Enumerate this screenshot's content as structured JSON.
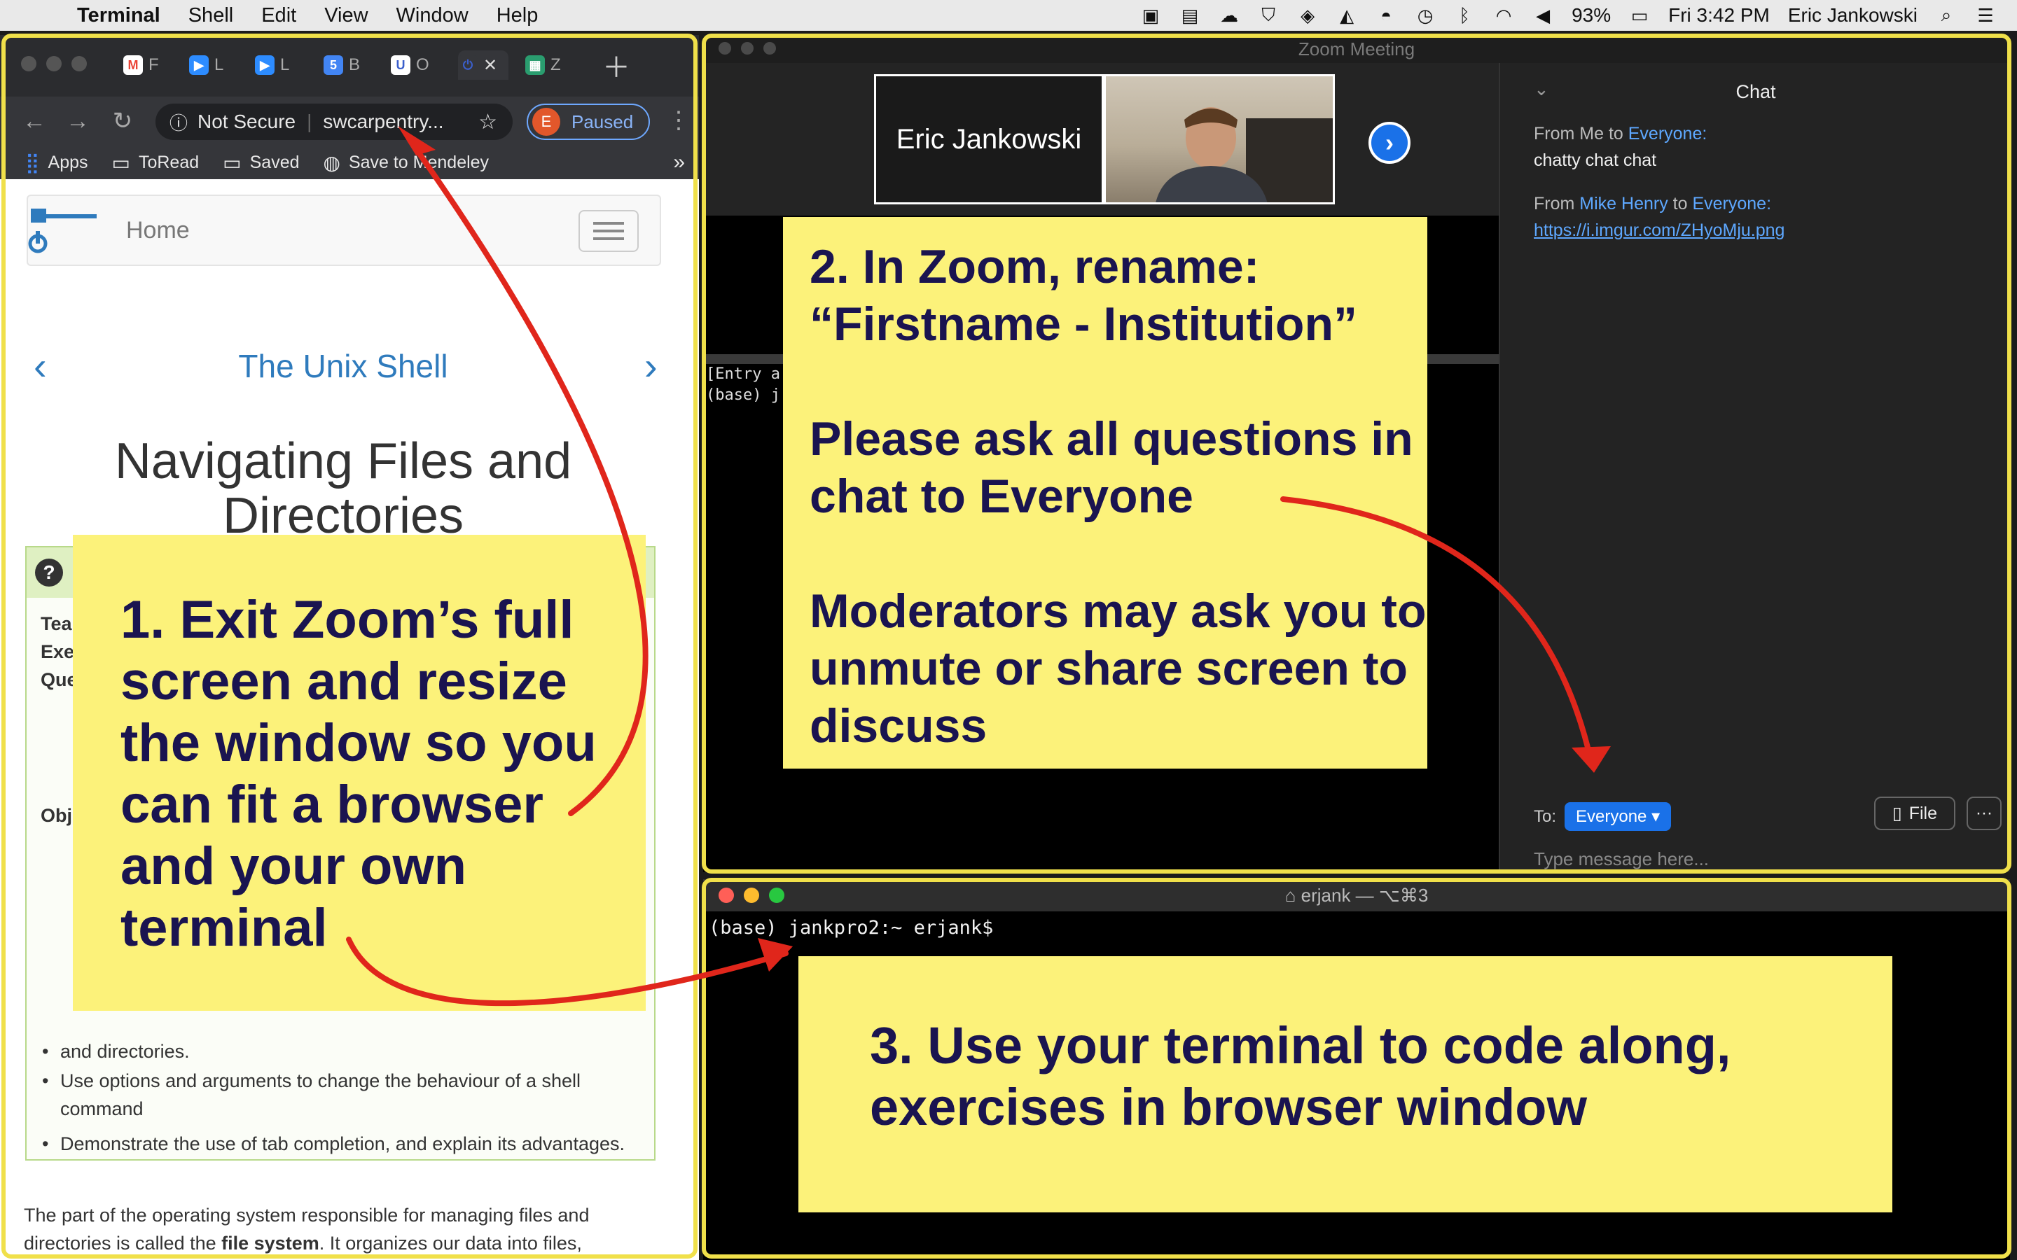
{
  "menubar": {
    "app": "Terminal",
    "menus": [
      "Shell",
      "Edit",
      "View",
      "Window",
      "Help"
    ],
    "battery": "93%",
    "clock": "Fri 3:42 PM",
    "user": "Eric Jankowski"
  },
  "browser": {
    "tabs": [
      {
        "initial": "F",
        "icon": "gmail-icon",
        "color": "#ea4335"
      },
      {
        "initial": "L",
        "icon": "zoom-icon",
        "color": "#2d8cff"
      },
      {
        "initial": "L",
        "icon": "zoom-icon",
        "color": "#2d8cff"
      },
      {
        "initial": "B",
        "icon": "calendar-icon",
        "color": "#4285f4"
      },
      {
        "initial": "O",
        "icon": "carpentries-icon",
        "color": "#3b5fcc"
      }
    ],
    "security_label": "Not Secure",
    "url": "swcarpentry...",
    "paused_label": "Paused",
    "avatar_initial": "E",
    "bookmarks": [
      "Apps",
      "ToRead",
      "Saved",
      "Save to Mendeley"
    ]
  },
  "page": {
    "nav_home": "Home",
    "lesson": "The Unix Shell",
    "title": "Navigating Files and Directories",
    "teaching_label": "Tea",
    "exercises_label": "Exe",
    "questions_label": "Que",
    "objectives_label": "Obj",
    "partial_bullet": "and directories.",
    "bullets": [
      "Use options and arguments to change the behaviour of a shell command",
      "Demonstrate the use of tab completion, and explain its advantages."
    ],
    "para_start": "The part of the operating system responsible for managing files and directories is called the ",
    "para_bold": "file system",
    "para_end": ". It organizes our data into files,"
  },
  "zoom": {
    "window_title": "Zoom Meeting",
    "participant_name": "Eric Jankowski",
    "mini_term_line1": "[Entry a",
    "mini_term_line2": "(base) j",
    "chat": {
      "title": "Chat",
      "msg1_from": "From Me to ",
      "msg1_to": "Everyone:",
      "msg1_text": "chatty chat chat",
      "msg2_from": "From ",
      "msg2_sender": "Mike Henry",
      "msg2_mid": " to ",
      "msg2_to": "Everyone:",
      "msg2_link": "https://i.imgur.com/ZHyoMju.png",
      "to_label": "To:",
      "recipient": "Everyone",
      "file_label": "File",
      "placeholder": "Type message here..."
    }
  },
  "terminal": {
    "title": "erjank — ⌥⌘3",
    "prompt": "(base) jankpro2:~ erjank$"
  },
  "notes": {
    "note1": "1. Exit Zoom’s full screen and resize the window so you can fit a browser and your own terminal",
    "note2_p1": "2. In Zoom, rename: “Firstname - Institution”",
    "note2_p2": "Please ask all questions in chat to Everyone",
    "note2_p3": "Moderators may ask you to unmute or share screen to discuss",
    "note3": "3. Use your terminal to code along, exercises in browser window"
  },
  "colors": {
    "note_yellow": "#fcf27a",
    "frame_yellow": "#f0e04a",
    "arrow_red": "#e0261b",
    "link_blue": "#2f7bbd",
    "zoom_blue": "#1a71e8"
  }
}
